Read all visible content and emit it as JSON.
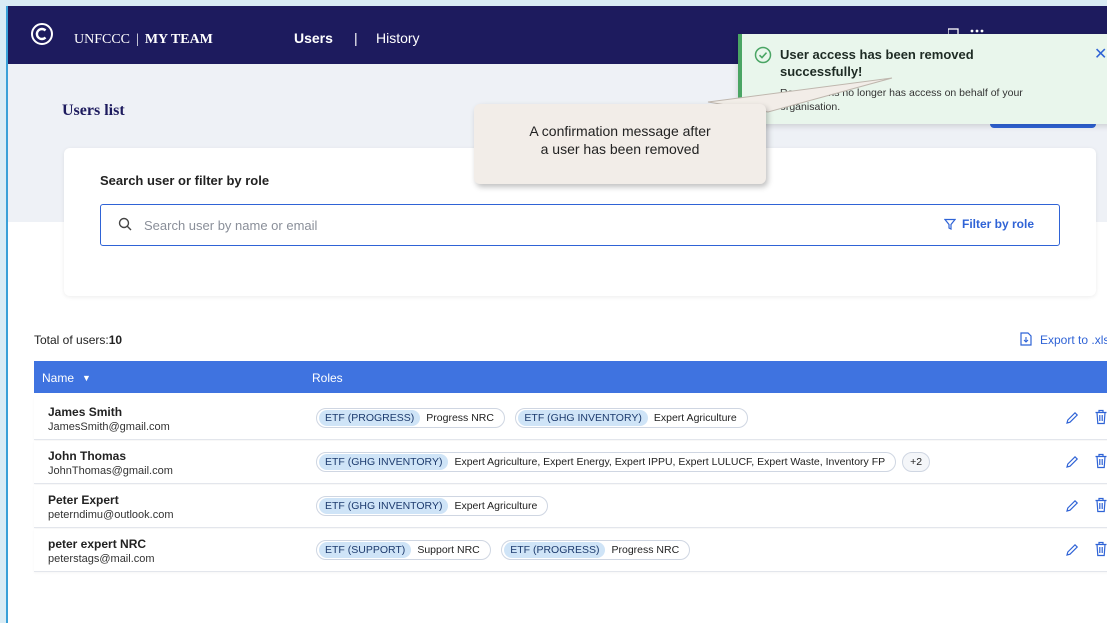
{
  "nav": {
    "brand_org": "UNFCCC",
    "brand_sep": "|",
    "brand_app": "MY TEAM",
    "tabs": [
      {
        "label": "Users",
        "active": true
      },
      {
        "label": "History",
        "active": false
      }
    ],
    "divider": "|"
  },
  "page": {
    "title": "Users list"
  },
  "search": {
    "label": "Search user or filter by role",
    "placeholder": "Search user by name or email",
    "filter_label": "Filter by role"
  },
  "table": {
    "total_label": "Total of users:",
    "total_value": "10",
    "export_label": "Export to .xls",
    "columns": {
      "name": "Name",
      "roles": "Roles"
    },
    "rows": [
      {
        "name": "James Smith",
        "email": "JamesSmith@gmail.com",
        "roles": [
          {
            "group": "ETF (PROGRESS)",
            "roles": "Progress NRC"
          },
          {
            "group": "ETF (GHG INVENTORY)",
            "roles": "Expert Agriculture"
          }
        ],
        "more": ""
      },
      {
        "name": "John Thomas",
        "email": "JohnThomas@gmail.com",
        "roles": [
          {
            "group": "ETF (GHG INVENTORY)",
            "roles": "Expert Agriculture, Expert Energy, Expert IPPU, Expert LULUCF, Expert Waste, Inventory FP"
          }
        ],
        "more": "+2"
      },
      {
        "name": "Peter Expert",
        "email": "peterndimu@outlook.com",
        "roles": [
          {
            "group": "ETF (GHG INVENTORY)",
            "roles": "Expert Agriculture"
          }
        ],
        "more": ""
      },
      {
        "name": "peter expert NRC",
        "email": "peterstags@mail.com",
        "roles": [
          {
            "group": "ETF (SUPPORT)",
            "roles": "Support NRC"
          },
          {
            "group": "ETF (PROGRESS)",
            "roles": "Progress NRC"
          }
        ],
        "more": ""
      }
    ]
  },
  "toast": {
    "title": "User access has been removed successfully!",
    "body": "Roger Harris no longer has access on behalf of your organisation.",
    "close": "✕"
  },
  "callout": {
    "line1": "A confirmation message after",
    "line2": "a user has been  removed"
  },
  "colors": {
    "nav_bg": "#1d1b5e",
    "accent": "#2f63d6",
    "table_header": "#3f73e0",
    "success": "#4aa564",
    "toast_bg": "#e9f6ec"
  }
}
